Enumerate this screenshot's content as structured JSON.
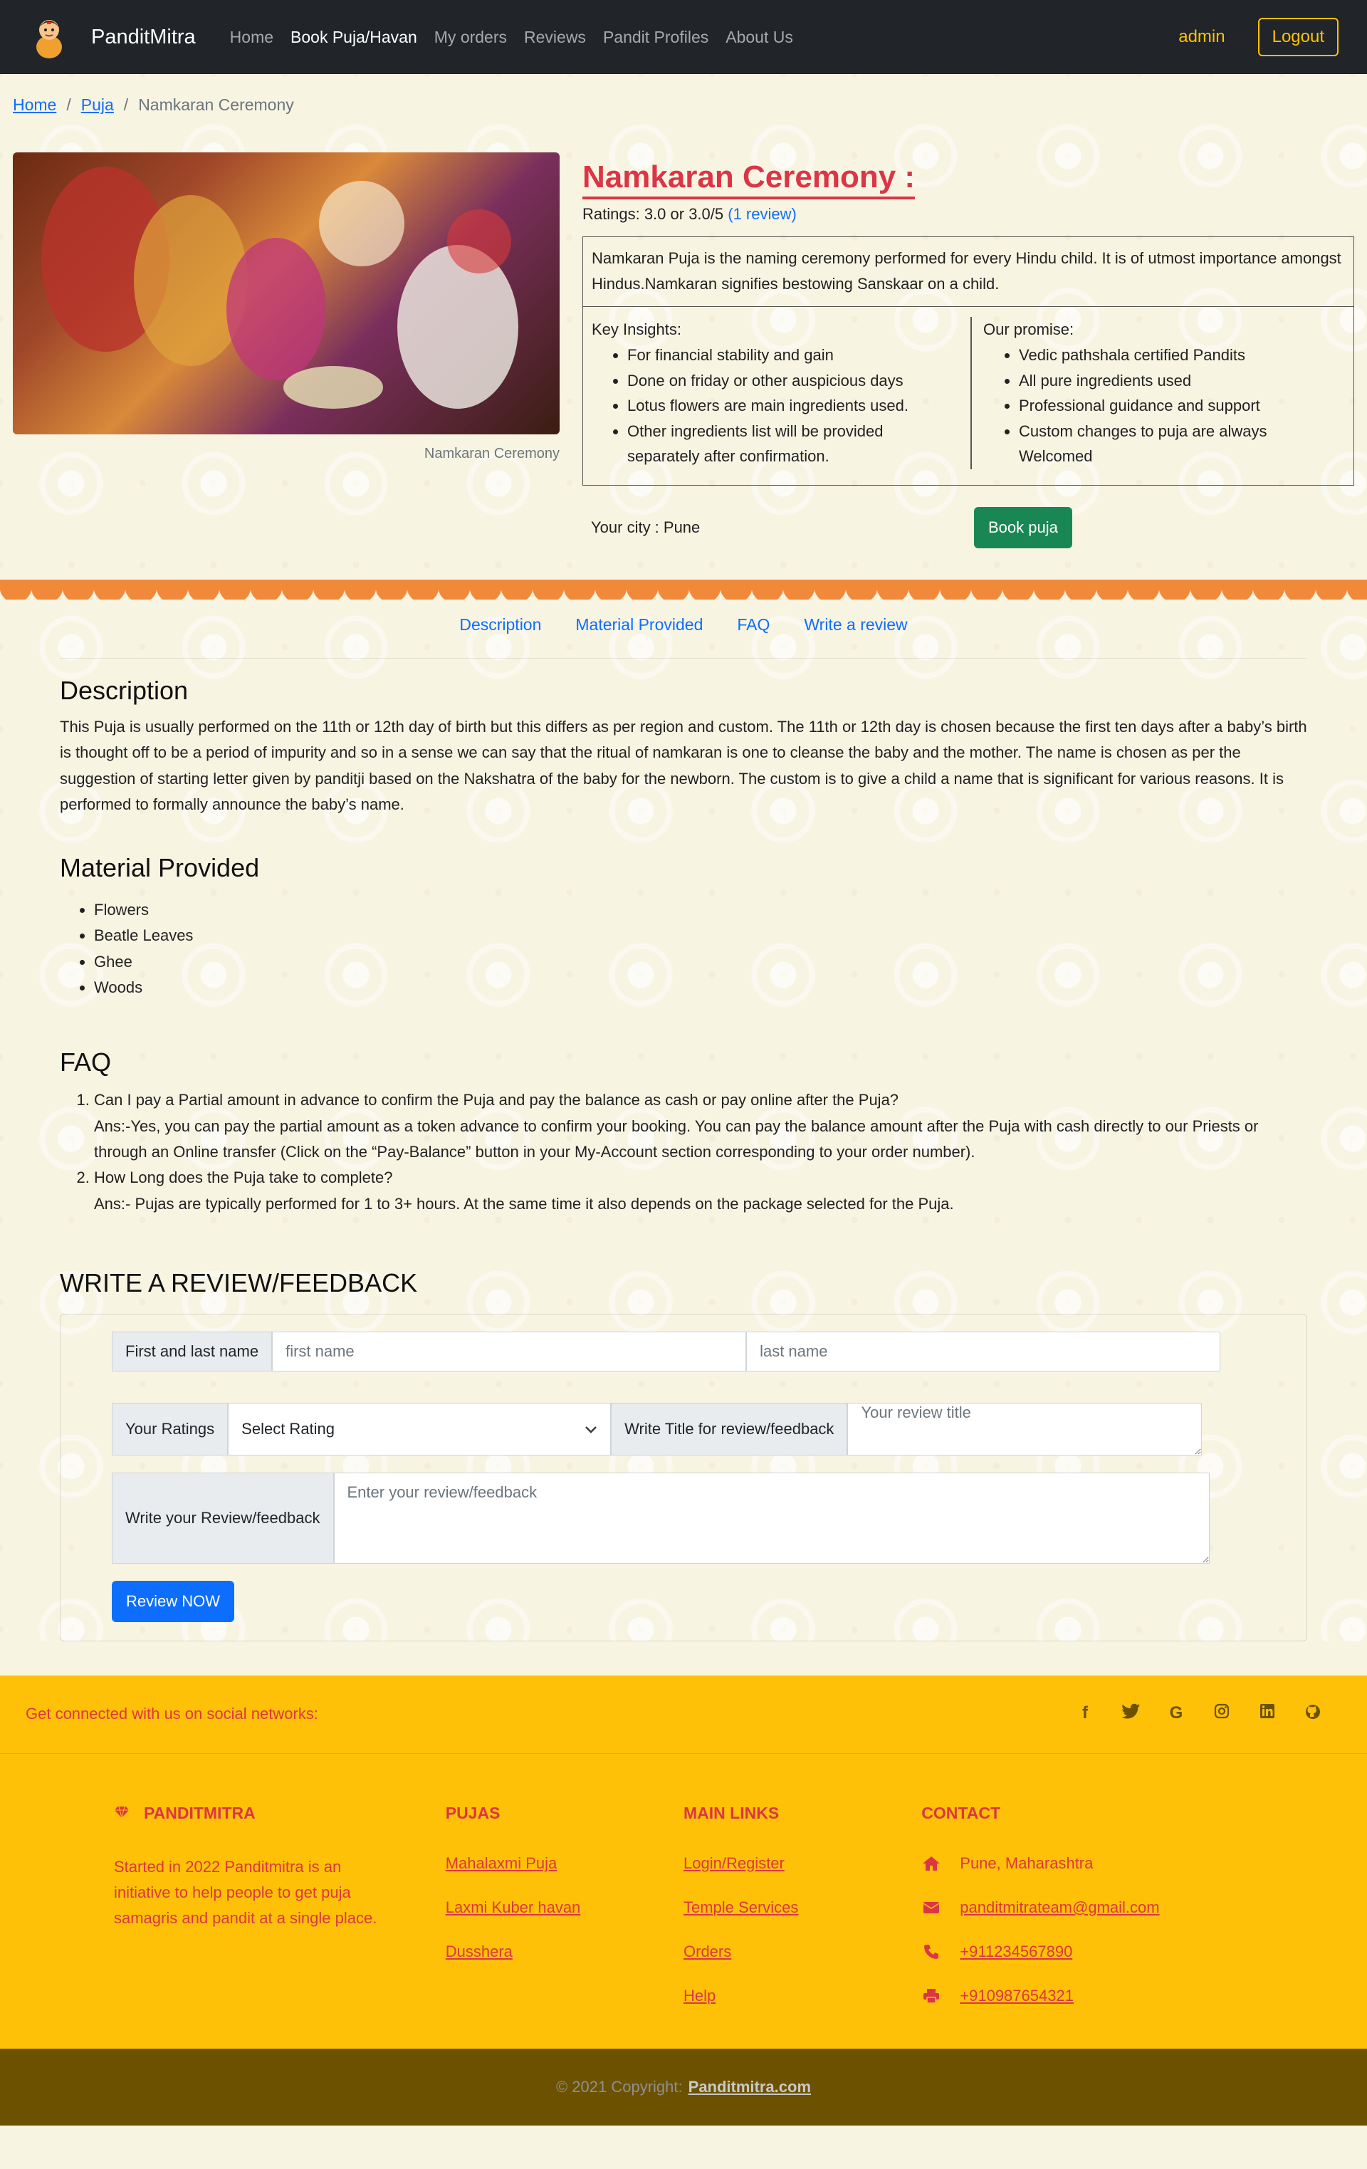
{
  "nav": {
    "brand": "PanditMitra",
    "links": [
      "Home",
      "Book Puja/Havan",
      "My orders",
      "Reviews",
      "Pandit Profiles",
      "About Us"
    ],
    "active_index": 1,
    "user": "admin",
    "logout": "Logout"
  },
  "breadcrumb": {
    "items": [
      "Home",
      "Puja",
      "Namkaran Ceremony"
    ],
    "separator": "/"
  },
  "puja": {
    "image_caption": "Namkaran Ceremony",
    "title": "Namkaran Ceremony :",
    "ratings_text": "Ratings: 3.0 or 3.0/5",
    "review_link": "(1 review)",
    "description": "Namkaran Puja is the naming ceremony performed for every Hindu child. It is of utmost importance amongst Hindus.Namkaran signifies bestowing Sanskaar on a child.",
    "insights_title": "Key Insights:",
    "insights": [
      "For financial stability and gain",
      "Done on friday or other auspicious days",
      "Lotus flowers are main ingredients used.",
      "Other ingredients list will be provided separately after confirmation."
    ],
    "promise_title": "Our promise:",
    "promises": [
      "Vedic pathshala certified Pandits",
      "All pure ingredients used",
      "Professional guidance and support",
      "Custom changes to puja are always Welcomed"
    ],
    "city_text": "Your city : Pune",
    "book_button": "Book puja"
  },
  "tabs": [
    "Description",
    "Material Provided",
    "FAQ",
    "Write a review"
  ],
  "description": {
    "heading": "Description",
    "text": "This Puja is usually performed on the 11th or 12th day of birth but this differs as per region and custom. The 11th or 12th day is chosen because the first ten days after a baby’s birth is thought off to be a period of impurity and so in a sense we can say that the ritual of namkaran is one to cleanse the baby and the mother. The name is chosen as per the suggestion of starting letter given by panditji based on the Nakshatra of the baby for the newborn. The custom is to give a child a name that is significant for various reasons. It is performed to formally announce the baby’s name."
  },
  "materials": {
    "heading": "Material Provided",
    "items": [
      "Flowers",
      "Beatle Leaves",
      "Ghee",
      "Woods"
    ]
  },
  "faq": {
    "heading": "FAQ",
    "items": [
      {
        "q": "Can I pay a Partial amount in advance to confirm the Puja and pay the balance as cash or pay online after the Puja?",
        "a": "Ans:-Yes, you can pay the partial amount as a token advance to confirm your booking. You can pay the balance amount after the Puja with cash directly to our Priests or through an Online transfer (Click on the “Pay-Balance” button in your My-Account section corresponding to your order number)."
      },
      {
        "q": "How Long does the Puja take to complete?",
        "a": "Ans:- Pujas are typically performed for 1 to 3+ hours. At the same time it also depends on the package selected for the Puja."
      }
    ]
  },
  "review": {
    "heading": "WRITE A REVIEW/FEEDBACK",
    "name_label": "First and last name",
    "first_placeholder": "first name",
    "last_placeholder": "last name",
    "rating_label": "Your Ratings",
    "rating_value": "Select Rating",
    "title_label": "Write Title for review/feedback",
    "title_placeholder": "Your review title",
    "body_label": "Write your Review/feedback",
    "body_placeholder": "Enter your review/feedback",
    "submit": "Review NOW"
  },
  "footer": {
    "social_text": "Get connected with us on social networks:",
    "social_icons": [
      "facebook-icon",
      "twitter-icon",
      "google-icon",
      "instagram-icon",
      "linkedin-icon",
      "github-icon"
    ],
    "about_heading": "PANDITMITRA",
    "about_text": "Started in 2022 Panditmitra is an initiative to help people to get puja samagris and pandit at a single place.",
    "pujas_heading": "PUJAS",
    "pujas": [
      "Mahalaxmi Puja",
      "Laxmi Kuber havan",
      "Dusshera"
    ],
    "links_heading": "MAIN LINKS",
    "links": [
      "Login/Register",
      "Temple Services",
      "Orders",
      "Help"
    ],
    "contact_heading": "CONTACT",
    "address": "Pune, Maharashtra",
    "email": "panditmitrateam@gmail.com",
    "phone": "+911234567890",
    "fax": "+910987654321",
    "copyright_prefix": "© 2021 Copyright:",
    "copyright_link": "Panditmitra.com"
  },
  "colors": {
    "navbar": "#212529",
    "accent_red": "#dc3545",
    "accent_yellow": "#ffc107",
    "link_blue": "#0d6efd",
    "book_green": "#198754",
    "decor_orange": "#f1893a",
    "copyright_bg": "#6c5200"
  }
}
